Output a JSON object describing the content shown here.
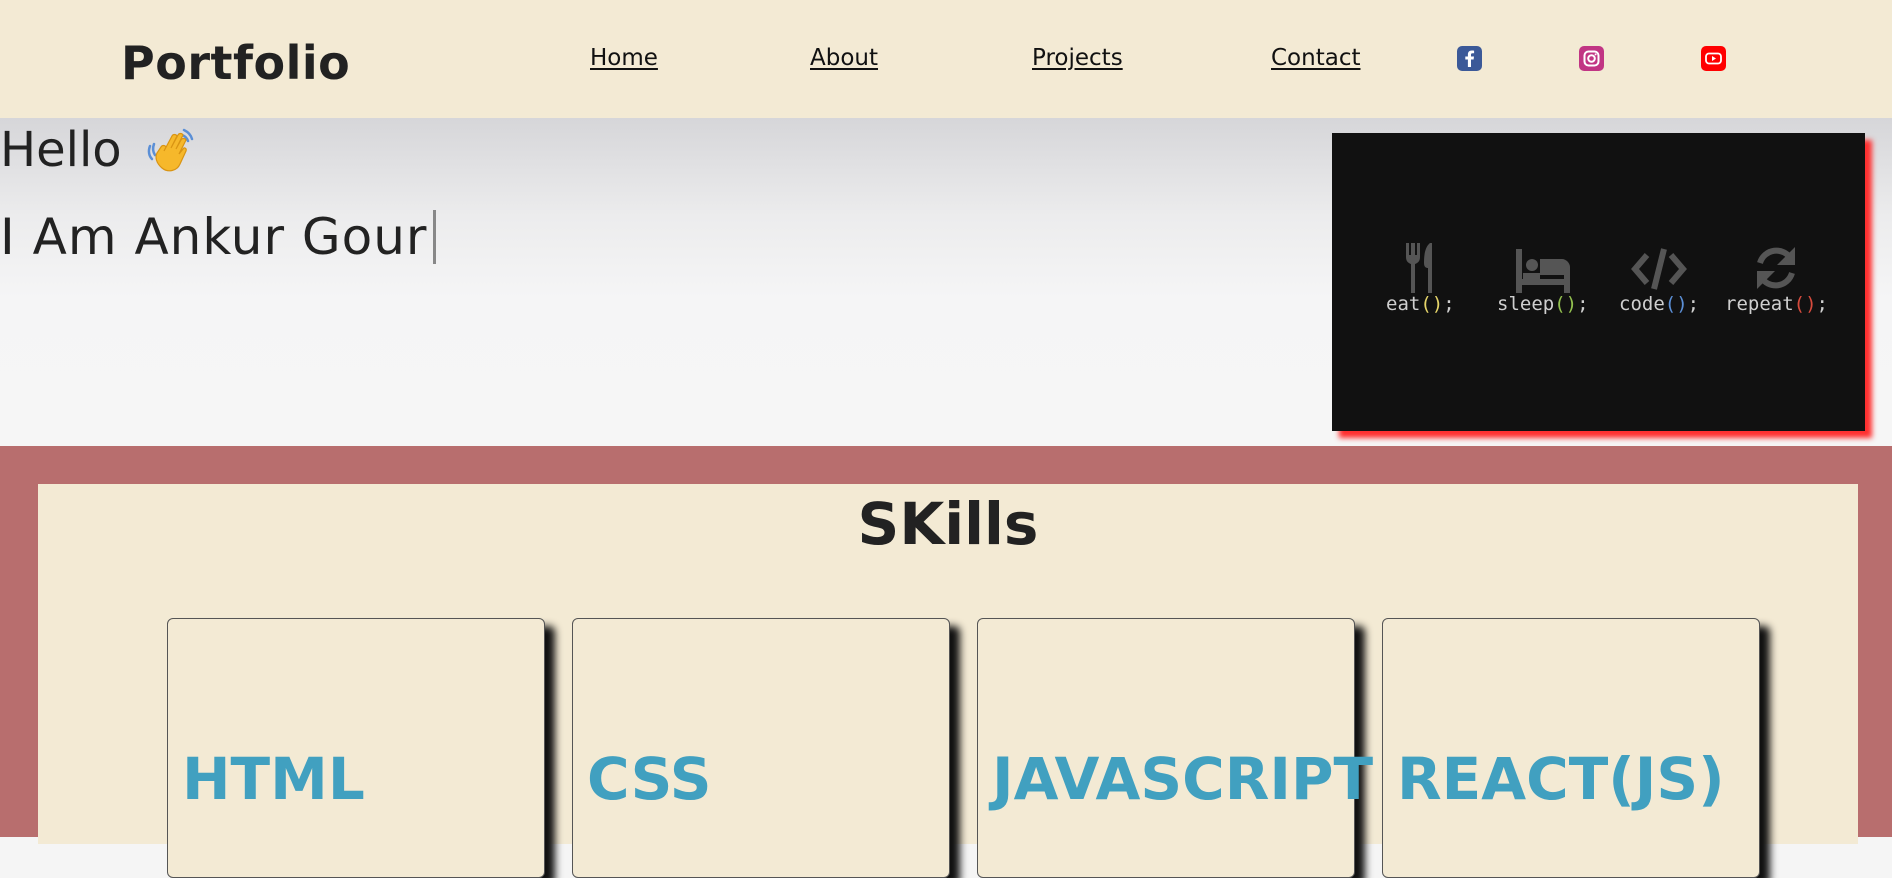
{
  "navbar": {
    "brand": "Portfolio",
    "links": [
      {
        "label": "Home"
      },
      {
        "label": "About"
      },
      {
        "label": "Projects"
      },
      {
        "label": "Contact"
      }
    ],
    "social": [
      {
        "icon": "facebook-icon",
        "color": "#3b5998"
      },
      {
        "icon": "instagram-icon",
        "color": "#c13584"
      },
      {
        "icon": "youtube-icon",
        "color": "#ff0000"
      }
    ],
    "background": "#f3ead4"
  },
  "hero": {
    "greeting": "Hello",
    "greeting_emoji": "waving-hand-icon",
    "intro": "I Am Ankur Gour",
    "motto": [
      {
        "icon": "fork-knife-icon",
        "label": "eat",
        "parens": "()",
        "suffix": ";",
        "paren_color": "#e6d56a"
      },
      {
        "icon": "bed-icon",
        "label": "sleep",
        "parens": "()",
        "suffix": ";",
        "paren_color": "#92c04f"
      },
      {
        "icon": "code-icon",
        "label": "code",
        "parens": "()",
        "suffix": ";",
        "paren_color": "#5b8fd6"
      },
      {
        "icon": "refresh-icon",
        "label": "repeat",
        "parens": "()",
        "suffix": ";",
        "paren_color": "#d64b3d"
      }
    ]
  },
  "skills": {
    "title": "SKills",
    "items": [
      {
        "name": "HTML"
      },
      {
        "name": "CSS"
      },
      {
        "name": "JAVASCRIPT"
      },
      {
        "name": "REACT(JS)"
      }
    ],
    "accent_color": "#41a0c0",
    "section_background": "#b86e6e"
  }
}
